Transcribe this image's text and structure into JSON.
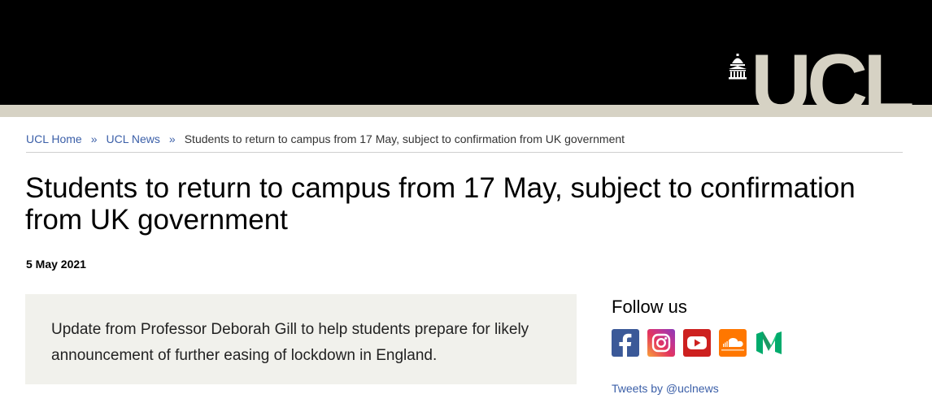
{
  "header": {
    "logo_text": "UCL"
  },
  "breadcrumb": {
    "items": [
      {
        "label": "UCL Home"
      },
      {
        "label": "UCL News"
      }
    ],
    "separator": "»",
    "current": "Students to return to campus from 17 May, subject to confirmation from UK government"
  },
  "article": {
    "title": "Students to return to campus from 17 May, subject to confirmation from UK government",
    "date": "5 May 2021",
    "summary": "Update from Professor Deborah Gill to help students prepare for likely announcement of further easing of lockdown in England."
  },
  "sidebar": {
    "follow_heading": "Follow us",
    "socials": [
      {
        "name": "Facebook",
        "icon": "facebook-icon",
        "color": "#3b5998"
      },
      {
        "name": "Instagram",
        "icon": "instagram-icon",
        "color": "#c23391"
      },
      {
        "name": "YouTube",
        "icon": "youtube-icon",
        "color": "#cd201f"
      },
      {
        "name": "SoundCloud",
        "icon": "soundcloud-icon",
        "color": "#ff7700"
      },
      {
        "name": "Medium",
        "icon": "medium-icon",
        "color": "#00ab6c"
      }
    ],
    "tweets_link": "Tweets by @uclnews"
  },
  "colors": {
    "header_bg": "#000000",
    "band": "#d6d2c4",
    "link": "#3b5fa8",
    "summary_bg": "#f1f1ec"
  }
}
